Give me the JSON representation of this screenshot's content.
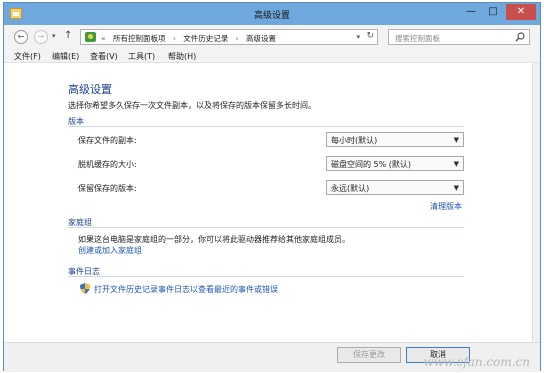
{
  "window": {
    "title": "高级设置",
    "min_glyph": "—",
    "max_glyph": "□",
    "close_glyph": "✕"
  },
  "nav": {
    "back_glyph": "←",
    "forward_glyph": "→",
    "recent_glyph": "▾",
    "up_glyph": "↑",
    "crumbs": [
      "«",
      "所有控制面板项",
      "›",
      "文件历史记录",
      "›",
      "高级设置"
    ],
    "dropdown_glyph": "▾",
    "refresh_glyph": "↻",
    "search_placeholder": "搜索控制面板"
  },
  "menu": [
    "文件(F)",
    "编辑(E)",
    "查看(V)",
    "工具(T)",
    "帮助(H)"
  ],
  "main": {
    "title": "高级设置",
    "description": "选择你希望多久保存一次文件副本，以及将保存的版本保留多长时间。",
    "versions": {
      "heading": "版本",
      "rows": [
        {
          "label": "保存文件的副本:",
          "value": "每小时(默认)"
        },
        {
          "label": "脱机缓存的大小:",
          "value": "磁盘空间的 5% (默认)"
        },
        {
          "label": "保留保存的版本:",
          "value": "永远(默认)"
        }
      ],
      "cleanup_link": "清理版本"
    },
    "homegroup": {
      "heading": "家庭组",
      "text": "如果这台电脑是家庭组的一部分，你可以将此驱动器推荐给其他家庭组成员。",
      "link": "创建或加入家庭组"
    },
    "eventlog": {
      "heading": "事件日志",
      "link": "打开文件历史记录事件日志以查看最近的事件或错误"
    }
  },
  "footer": {
    "save_label": "保存更改",
    "cancel_label": "取消",
    "watermark": "www.cfan.com.cn"
  },
  "colors": {
    "frame": "#6fa8dc",
    "heading": "#1d3f8e",
    "link": "#1f56b4",
    "close": "#c7504a"
  }
}
